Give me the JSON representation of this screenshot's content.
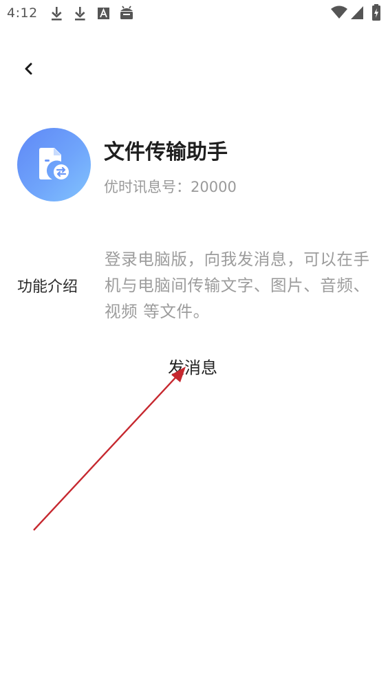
{
  "status_bar": {
    "time": "4:12",
    "left_icons": [
      "download-icon",
      "download-icon",
      "font-a-icon",
      "android-icon"
    ],
    "right_icons": [
      "wifi-icon",
      "cell-signal-icon",
      "battery-charging-icon"
    ]
  },
  "header": {
    "back_icon": "back-chevron-icon"
  },
  "contact": {
    "avatar_icon": "file-transfer-icon",
    "name": "文件传输助手",
    "id_line": "优时讯息号：20000"
  },
  "intro": {
    "label": "功能介绍",
    "text": "登录电脑版，向我发消息，可以在手机与电脑间传输文字、图片、音频、视频 等文件。"
  },
  "actions": {
    "send_message": "发消息"
  },
  "colors": {
    "avatar_gradient_start": "#5f88f6",
    "avatar_gradient_end": "#82c3fd",
    "annotation_arrow": "#c6282f",
    "secondary_text": "#9c9c9c"
  }
}
